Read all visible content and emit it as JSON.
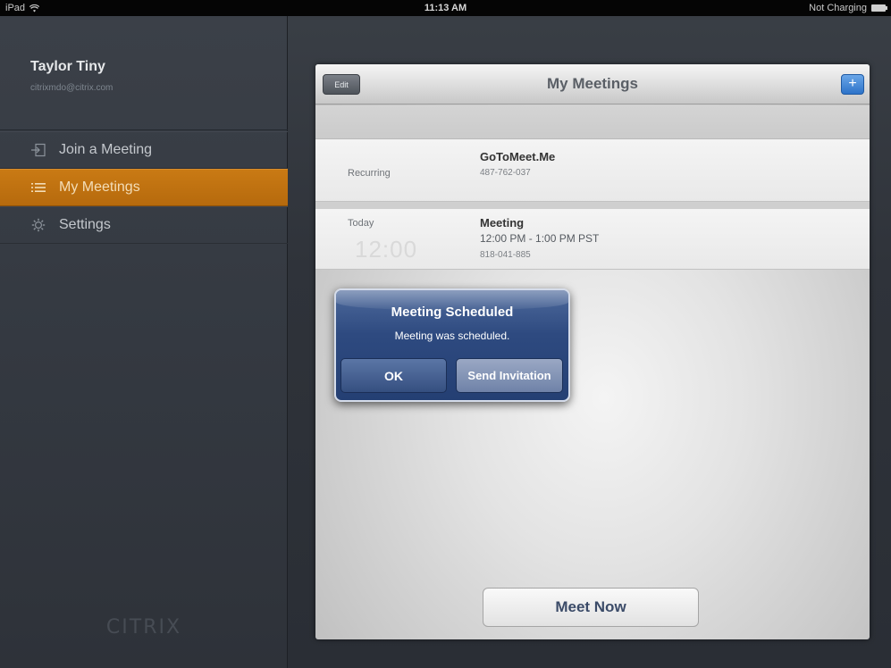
{
  "status_bar": {
    "device": "iPad",
    "time": "11:13 AM",
    "charging": "Not Charging",
    "icons": [
      "wifi-icon",
      "battery-icon"
    ]
  },
  "sidebar": {
    "profile": {
      "name": "Taylor Tiny",
      "email": "citrixmdo@citrix.com"
    },
    "items": [
      {
        "label": "Join a Meeting",
        "icon": "join-meeting-icon",
        "active": false
      },
      {
        "label": "My Meetings",
        "icon": "list-icon",
        "active": true
      },
      {
        "label": "Settings",
        "icon": "gear-icon",
        "active": false
      }
    ],
    "logo": "CITRIX"
  },
  "panel": {
    "title": "My Meetings",
    "edit_label": "Edit",
    "add_label": "+",
    "meetings": [
      {
        "label": "Recurring",
        "title": "GoToMeet.Me",
        "id": "487-762-037"
      },
      {
        "label": "Today",
        "time_big": "12:00",
        "title": "Meeting",
        "time_range": "12:00 PM - 1:00 PM PST",
        "id": "818-041-885"
      }
    ],
    "meet_now_label": "Meet Now"
  },
  "alert": {
    "title": "Meeting Scheduled",
    "message": "Meeting was scheduled.",
    "ok_label": "OK",
    "send_label": "Send Invitation"
  },
  "colors": {
    "accent_orange": "#c47614",
    "alert_blue": "#2e4a80",
    "add_button_blue": "#2d73c9"
  }
}
